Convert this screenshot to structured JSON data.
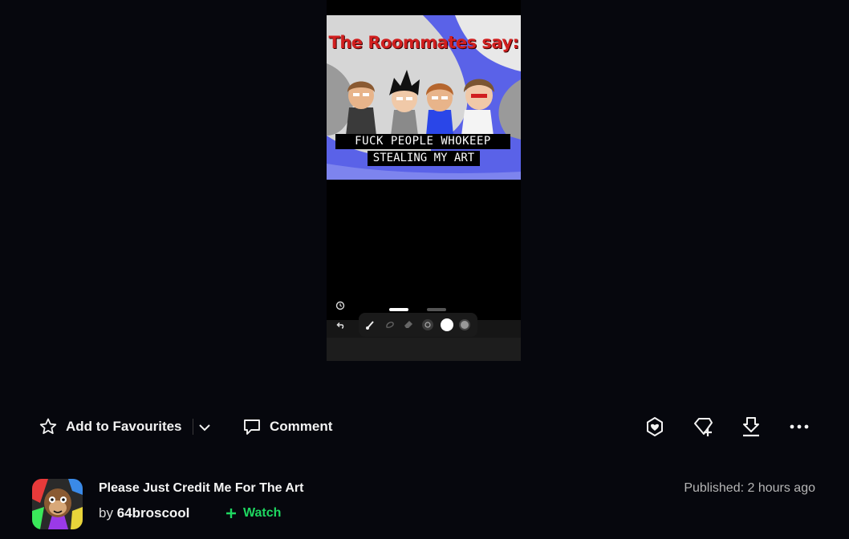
{
  "artwork": {
    "title_text": "The Roommates say:",
    "caption_line1": "FUCK PEOPLE WHOKEEP",
    "caption_line2": "STEALING MY ART"
  },
  "actions": {
    "favourite_label": "Add to Favourites",
    "comment_label": "Comment",
    "icons": [
      "give-icon",
      "add-to-collection-icon",
      "download-icon",
      "more-icon"
    ]
  },
  "deviation": {
    "title": "Please Just Credit Me For The Art",
    "by_prefix": "by",
    "author": "64broscool",
    "watch_label": "Watch",
    "published": "Published: 2 hours ago"
  },
  "colors": {
    "background": "#06070d",
    "watch_green": "#1ed760",
    "art_title_red": "#d11f1f",
    "art_blue": "#5a62e8"
  }
}
